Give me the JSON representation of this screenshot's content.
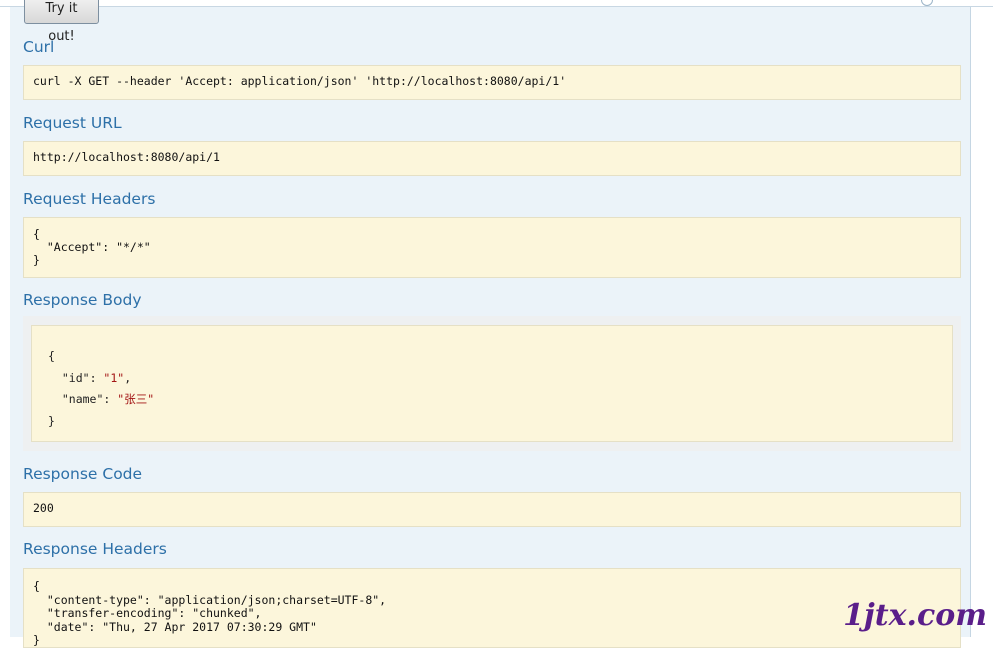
{
  "try_button": {
    "label": "Try it out!"
  },
  "sections": {
    "curl": {
      "title": "Curl",
      "value": "curl -X GET --header 'Accept: application/json' 'http://localhost:8080/api/1'"
    },
    "request_url": {
      "title": "Request URL",
      "value": "http://localhost:8080/api/1"
    },
    "request_headers": {
      "title": "Request Headers",
      "value": "{\n  \"Accept\": \"*/*\"\n}"
    },
    "response_body": {
      "title": "Response Body",
      "open_brace": "{",
      "lines": [
        {
          "key": "\"id\"",
          "sep": ": ",
          "val": "\"1\"",
          "end": ","
        },
        {
          "key": "\"name\"",
          "sep": ": ",
          "val": "\"张三\"",
          "end": ""
        }
      ],
      "close_brace": "}"
    },
    "response_code": {
      "title": "Response Code",
      "value": "200"
    },
    "response_headers": {
      "title": "Response Headers",
      "value": "{\n  \"content-type\": \"application/json;charset=UTF-8\",\n  \"transfer-encoding\": \"chunked\",\n  \"date\": \"Thu, 27 Apr 2017 07:30:29 GMT\"\n}"
    }
  },
  "watermark": {
    "text": "1jtx.com"
  },
  "colors": {
    "title": "#2d70a8",
    "code_bg": "#fcf6db",
    "panel_bg": "#ebf3f9",
    "json_string": "#a31515"
  }
}
